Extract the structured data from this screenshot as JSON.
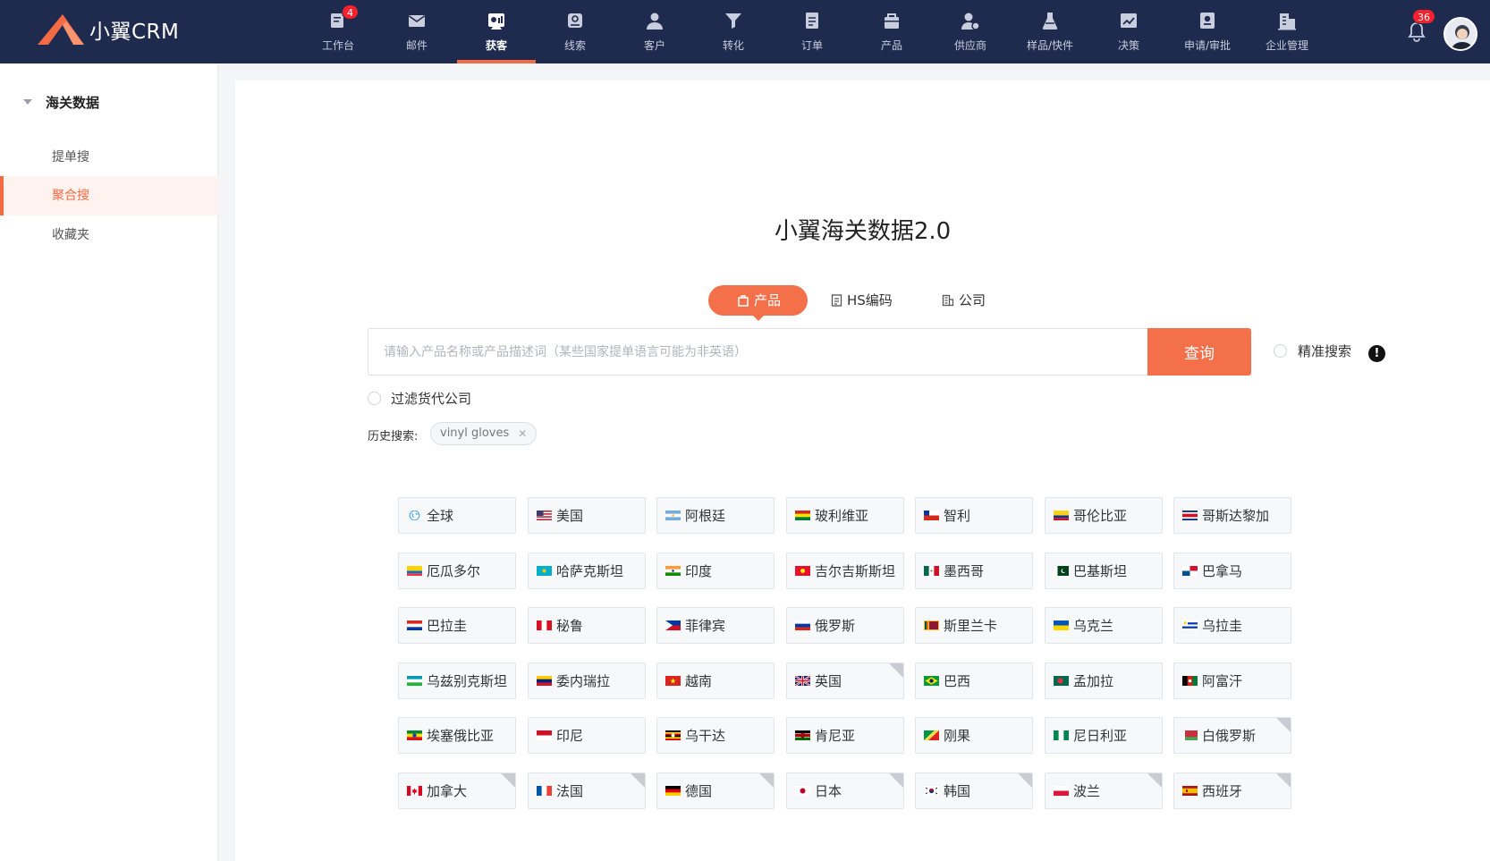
{
  "app": {
    "name": "小翼CRM"
  },
  "topnav": {
    "items": [
      {
        "label": "工作台",
        "icon": "workbench-icon",
        "badge": "4"
      },
      {
        "label": "邮件",
        "icon": "mail-icon"
      },
      {
        "label": "获客",
        "icon": "acquire-icon",
        "active": true
      },
      {
        "label": "线索",
        "icon": "leads-icon"
      },
      {
        "label": "客户",
        "icon": "customer-icon"
      },
      {
        "label": "转化",
        "icon": "funnel-icon"
      },
      {
        "label": "订单",
        "icon": "order-icon"
      },
      {
        "label": "产品",
        "icon": "product-icon"
      },
      {
        "label": "供应商",
        "icon": "supplier-icon"
      },
      {
        "label": "样品/快件",
        "icon": "flask-icon"
      },
      {
        "label": "决策",
        "icon": "chart-icon"
      },
      {
        "label": "申请/审批",
        "icon": "approval-icon"
      },
      {
        "label": "企业管理",
        "icon": "building-icon"
      }
    ],
    "notifications_badge": "36"
  },
  "sidebar": {
    "group_label": "海关数据",
    "items": [
      {
        "label": "提单搜"
      },
      {
        "label": "聚合搜",
        "active": true
      },
      {
        "label": "收藏夹"
      }
    ]
  },
  "main": {
    "title": "小翼海关数据2.0",
    "tabs": [
      {
        "label": "产品",
        "icon": "bag-icon",
        "active": true
      },
      {
        "label": "HS编码",
        "icon": "document-icon"
      },
      {
        "label": "公司",
        "icon": "company-icon"
      }
    ],
    "search": {
      "placeholder": "请输入产品名称或产品描述词（某些国家提单语言可能为非英语）",
      "value": "",
      "button_label": "查询"
    },
    "precise_search_label": "精准搜索",
    "precise_search_checked": false,
    "filter_forwarder_label": "过滤货代公司",
    "filter_forwarder_checked": false,
    "history_label": "历史搜索:",
    "history_chips": [
      "vinyl gloves"
    ]
  },
  "countries": [
    {
      "name": "全球",
      "flag": "globe"
    },
    {
      "name": "美国",
      "flag": "us"
    },
    {
      "name": "阿根廷",
      "flag": "ar"
    },
    {
      "name": "玻利维亚",
      "flag": "bo"
    },
    {
      "name": "智利",
      "flag": "cl"
    },
    {
      "name": "哥伦比亚",
      "flag": "co"
    },
    {
      "name": "哥斯达黎加",
      "flag": "cr"
    },
    {
      "name": "厄瓜多尔",
      "flag": "ec"
    },
    {
      "name": "哈萨克斯坦",
      "flag": "kz"
    },
    {
      "name": "印度",
      "flag": "in"
    },
    {
      "name": "吉尔吉斯斯坦",
      "flag": "kg"
    },
    {
      "name": "墨西哥",
      "flag": "mx"
    },
    {
      "name": "巴基斯坦",
      "flag": "pk"
    },
    {
      "name": "巴拿马",
      "flag": "pa"
    },
    {
      "name": "巴拉圭",
      "flag": "py"
    },
    {
      "name": "秘鲁",
      "flag": "pe"
    },
    {
      "name": "菲律宾",
      "flag": "ph"
    },
    {
      "name": "俄罗斯",
      "flag": "ru"
    },
    {
      "name": "斯里兰卡",
      "flag": "lk"
    },
    {
      "name": "乌克兰",
      "flag": "ua"
    },
    {
      "name": "乌拉圭",
      "flag": "uy"
    },
    {
      "name": "乌兹别克斯坦",
      "flag": "uz"
    },
    {
      "name": "委内瑞拉",
      "flag": "ve"
    },
    {
      "name": "越南",
      "flag": "vn"
    },
    {
      "name": "英国",
      "flag": "gb",
      "corner": true
    },
    {
      "name": "巴西",
      "flag": "br"
    },
    {
      "name": "孟加拉",
      "flag": "bd"
    },
    {
      "name": "阿富汗",
      "flag": "af"
    },
    {
      "name": "埃塞俄比亚",
      "flag": "et"
    },
    {
      "name": "印尼",
      "flag": "id"
    },
    {
      "name": "乌干达",
      "flag": "ug"
    },
    {
      "name": "肯尼亚",
      "flag": "ke"
    },
    {
      "name": "刚果",
      "flag": "cg"
    },
    {
      "name": "尼日利亚",
      "flag": "ng"
    },
    {
      "name": "白俄罗斯",
      "flag": "by",
      "corner": true
    },
    {
      "name": "加拿大",
      "flag": "ca",
      "corner": true
    },
    {
      "name": "法国",
      "flag": "fr",
      "corner": true
    },
    {
      "name": "德国",
      "flag": "de",
      "corner": true
    },
    {
      "name": "日本",
      "flag": "jp",
      "corner": true
    },
    {
      "name": "韩国",
      "flag": "kr",
      "corner": true
    },
    {
      "name": "波兰",
      "flag": "pl",
      "corner": true
    },
    {
      "name": "西班牙",
      "flag": "es",
      "corner": true
    }
  ],
  "colors": {
    "nav_bg": "#1e2a4e",
    "accent": "#f4704b",
    "badge": "#f5222d"
  }
}
